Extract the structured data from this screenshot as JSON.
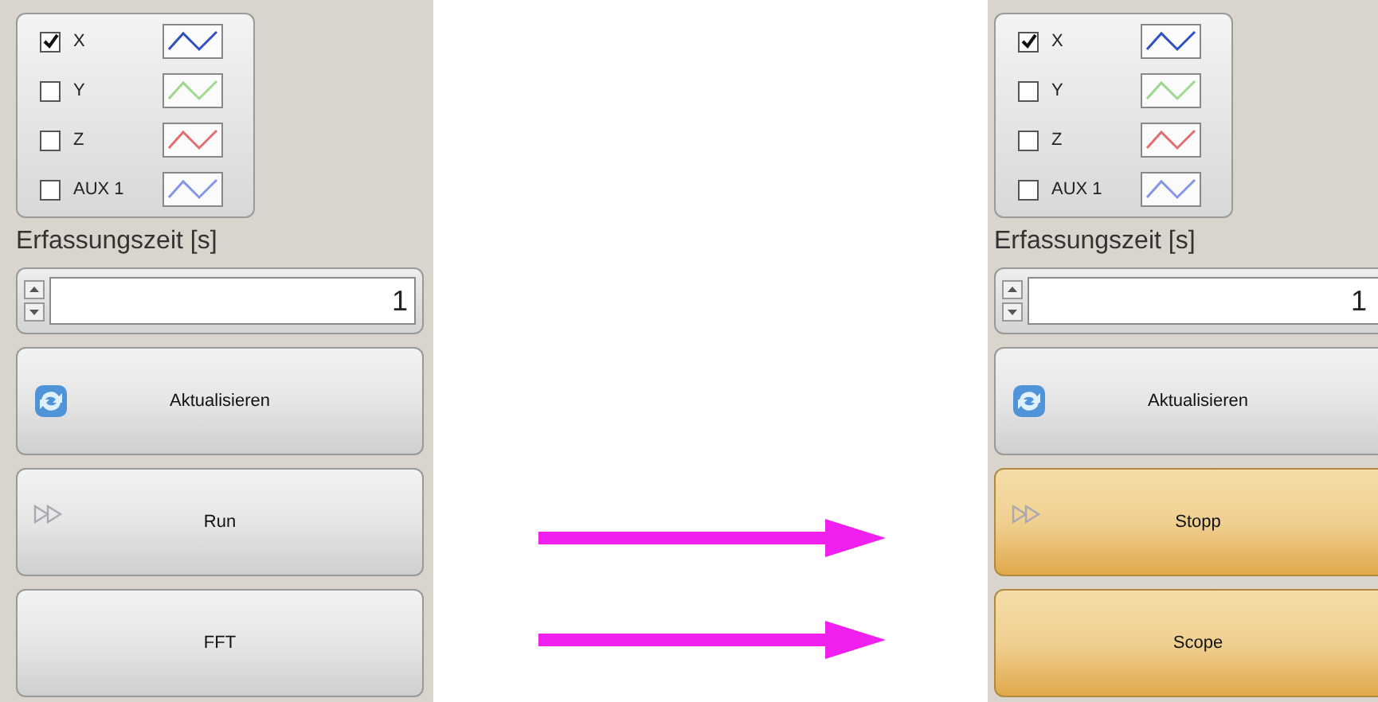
{
  "panels": [
    {
      "channels": [
        {
          "label": "X",
          "checked": true,
          "color": "#2f4fc4"
        },
        {
          "label": "Y",
          "checked": false,
          "color": "#9ed88c"
        },
        {
          "label": "Z",
          "checked": false,
          "color": "#e07070"
        },
        {
          "label": "AUX 1",
          "checked": false,
          "color": "#8496e6"
        }
      ],
      "acquisition_label": "Erfassungszeit [s]",
      "acquisition_value": "1",
      "buttons": [
        {
          "label": "Aktualisieren",
          "kind": "refresh",
          "active": false
        },
        {
          "label": "Run",
          "kind": "play",
          "active": false
        },
        {
          "label": "FFT",
          "kind": "plain",
          "active": false
        }
      ]
    },
    {
      "channels": [
        {
          "label": "X",
          "checked": true,
          "color": "#2f4fc4"
        },
        {
          "label": "Y",
          "checked": false,
          "color": "#9ed88c"
        },
        {
          "label": "Z",
          "checked": false,
          "color": "#e07070"
        },
        {
          "label": "AUX 1",
          "checked": false,
          "color": "#8496e6"
        }
      ],
      "acquisition_label": "Erfassungszeit [s]",
      "acquisition_value": "1",
      "buttons": [
        {
          "label": "Aktualisieren",
          "kind": "refresh",
          "active": false
        },
        {
          "label": "Stopp",
          "kind": "play",
          "active": true
        },
        {
          "label": "Scope",
          "kind": "plain",
          "active": true
        }
      ]
    }
  ]
}
